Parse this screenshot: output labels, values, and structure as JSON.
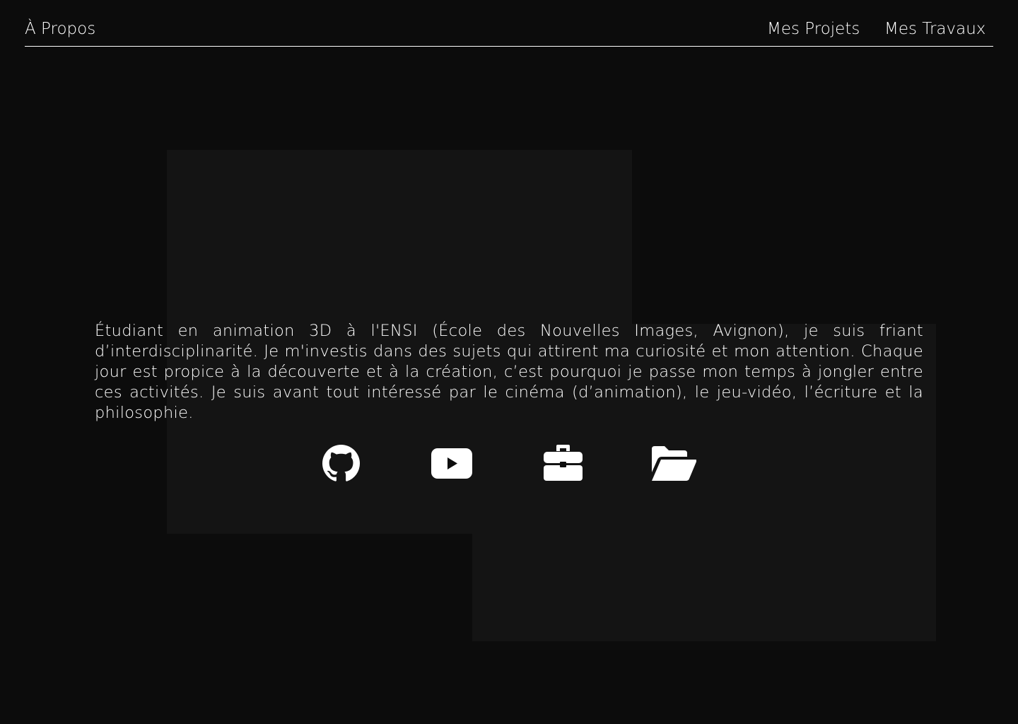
{
  "nav": {
    "about_label": "À Propos",
    "projects_label": "Mes Projets",
    "works_label": "Mes Travaux"
  },
  "bio": {
    "text": "Étudiant en animation 3D à l'ENSI (École des Nouvelles Images, Avignon), je suis friant d’interdisciplinarité. Je m'investis dans des sujets qui attirent ma curiosité et mon attention. Chaque jour est propice à la découverte et à la création, c’est pourquoi je passe mon temps à jongler entre ces activités. Je suis avant tout intéressé par le cinéma (d’animation), le jeu-vidéo, l’écriture et la philosophie."
  },
  "social_links": [
    {
      "icon": "github-icon"
    },
    {
      "icon": "youtube-icon"
    },
    {
      "icon": "briefcase-icon"
    },
    {
      "icon": "folder-open-icon"
    }
  ],
  "colors": {
    "background": "#0c0c0c",
    "panel": "#141414",
    "text": "#ffffff"
  }
}
